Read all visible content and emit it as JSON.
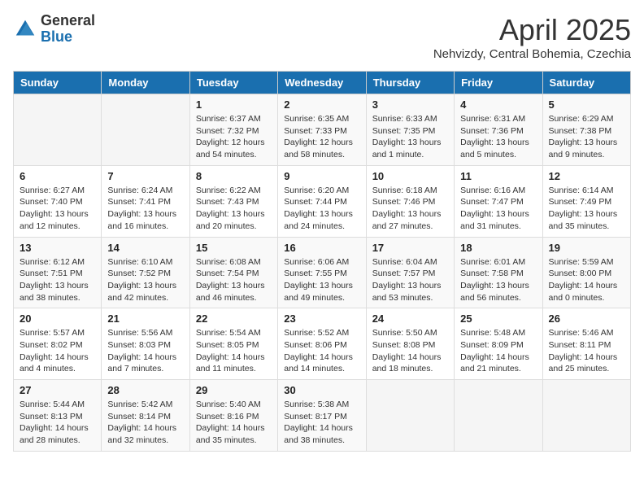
{
  "header": {
    "logo_general": "General",
    "logo_blue": "Blue",
    "month_title": "April 2025",
    "location": "Nehvizdy, Central Bohemia, Czechia"
  },
  "days_of_week": [
    "Sunday",
    "Monday",
    "Tuesday",
    "Wednesday",
    "Thursday",
    "Friday",
    "Saturday"
  ],
  "weeks": [
    [
      {
        "day": "",
        "info": ""
      },
      {
        "day": "",
        "info": ""
      },
      {
        "day": "1",
        "info": "Sunrise: 6:37 AM\nSunset: 7:32 PM\nDaylight: 12 hours and 54 minutes."
      },
      {
        "day": "2",
        "info": "Sunrise: 6:35 AM\nSunset: 7:33 PM\nDaylight: 12 hours and 58 minutes."
      },
      {
        "day": "3",
        "info": "Sunrise: 6:33 AM\nSunset: 7:35 PM\nDaylight: 13 hours and 1 minute."
      },
      {
        "day": "4",
        "info": "Sunrise: 6:31 AM\nSunset: 7:36 PM\nDaylight: 13 hours and 5 minutes."
      },
      {
        "day": "5",
        "info": "Sunrise: 6:29 AM\nSunset: 7:38 PM\nDaylight: 13 hours and 9 minutes."
      }
    ],
    [
      {
        "day": "6",
        "info": "Sunrise: 6:27 AM\nSunset: 7:40 PM\nDaylight: 13 hours and 12 minutes."
      },
      {
        "day": "7",
        "info": "Sunrise: 6:24 AM\nSunset: 7:41 PM\nDaylight: 13 hours and 16 minutes."
      },
      {
        "day": "8",
        "info": "Sunrise: 6:22 AM\nSunset: 7:43 PM\nDaylight: 13 hours and 20 minutes."
      },
      {
        "day": "9",
        "info": "Sunrise: 6:20 AM\nSunset: 7:44 PM\nDaylight: 13 hours and 24 minutes."
      },
      {
        "day": "10",
        "info": "Sunrise: 6:18 AM\nSunset: 7:46 PM\nDaylight: 13 hours and 27 minutes."
      },
      {
        "day": "11",
        "info": "Sunrise: 6:16 AM\nSunset: 7:47 PM\nDaylight: 13 hours and 31 minutes."
      },
      {
        "day": "12",
        "info": "Sunrise: 6:14 AM\nSunset: 7:49 PM\nDaylight: 13 hours and 35 minutes."
      }
    ],
    [
      {
        "day": "13",
        "info": "Sunrise: 6:12 AM\nSunset: 7:51 PM\nDaylight: 13 hours and 38 minutes."
      },
      {
        "day": "14",
        "info": "Sunrise: 6:10 AM\nSunset: 7:52 PM\nDaylight: 13 hours and 42 minutes."
      },
      {
        "day": "15",
        "info": "Sunrise: 6:08 AM\nSunset: 7:54 PM\nDaylight: 13 hours and 46 minutes."
      },
      {
        "day": "16",
        "info": "Sunrise: 6:06 AM\nSunset: 7:55 PM\nDaylight: 13 hours and 49 minutes."
      },
      {
        "day": "17",
        "info": "Sunrise: 6:04 AM\nSunset: 7:57 PM\nDaylight: 13 hours and 53 minutes."
      },
      {
        "day": "18",
        "info": "Sunrise: 6:01 AM\nSunset: 7:58 PM\nDaylight: 13 hours and 56 minutes."
      },
      {
        "day": "19",
        "info": "Sunrise: 5:59 AM\nSunset: 8:00 PM\nDaylight: 14 hours and 0 minutes."
      }
    ],
    [
      {
        "day": "20",
        "info": "Sunrise: 5:57 AM\nSunset: 8:02 PM\nDaylight: 14 hours and 4 minutes."
      },
      {
        "day": "21",
        "info": "Sunrise: 5:56 AM\nSunset: 8:03 PM\nDaylight: 14 hours and 7 minutes."
      },
      {
        "day": "22",
        "info": "Sunrise: 5:54 AM\nSunset: 8:05 PM\nDaylight: 14 hours and 11 minutes."
      },
      {
        "day": "23",
        "info": "Sunrise: 5:52 AM\nSunset: 8:06 PM\nDaylight: 14 hours and 14 minutes."
      },
      {
        "day": "24",
        "info": "Sunrise: 5:50 AM\nSunset: 8:08 PM\nDaylight: 14 hours and 18 minutes."
      },
      {
        "day": "25",
        "info": "Sunrise: 5:48 AM\nSunset: 8:09 PM\nDaylight: 14 hours and 21 minutes."
      },
      {
        "day": "26",
        "info": "Sunrise: 5:46 AM\nSunset: 8:11 PM\nDaylight: 14 hours and 25 minutes."
      }
    ],
    [
      {
        "day": "27",
        "info": "Sunrise: 5:44 AM\nSunset: 8:13 PM\nDaylight: 14 hours and 28 minutes."
      },
      {
        "day": "28",
        "info": "Sunrise: 5:42 AM\nSunset: 8:14 PM\nDaylight: 14 hours and 32 minutes."
      },
      {
        "day": "29",
        "info": "Sunrise: 5:40 AM\nSunset: 8:16 PM\nDaylight: 14 hours and 35 minutes."
      },
      {
        "day": "30",
        "info": "Sunrise: 5:38 AM\nSunset: 8:17 PM\nDaylight: 14 hours and 38 minutes."
      },
      {
        "day": "",
        "info": ""
      },
      {
        "day": "",
        "info": ""
      },
      {
        "day": "",
        "info": ""
      }
    ]
  ]
}
